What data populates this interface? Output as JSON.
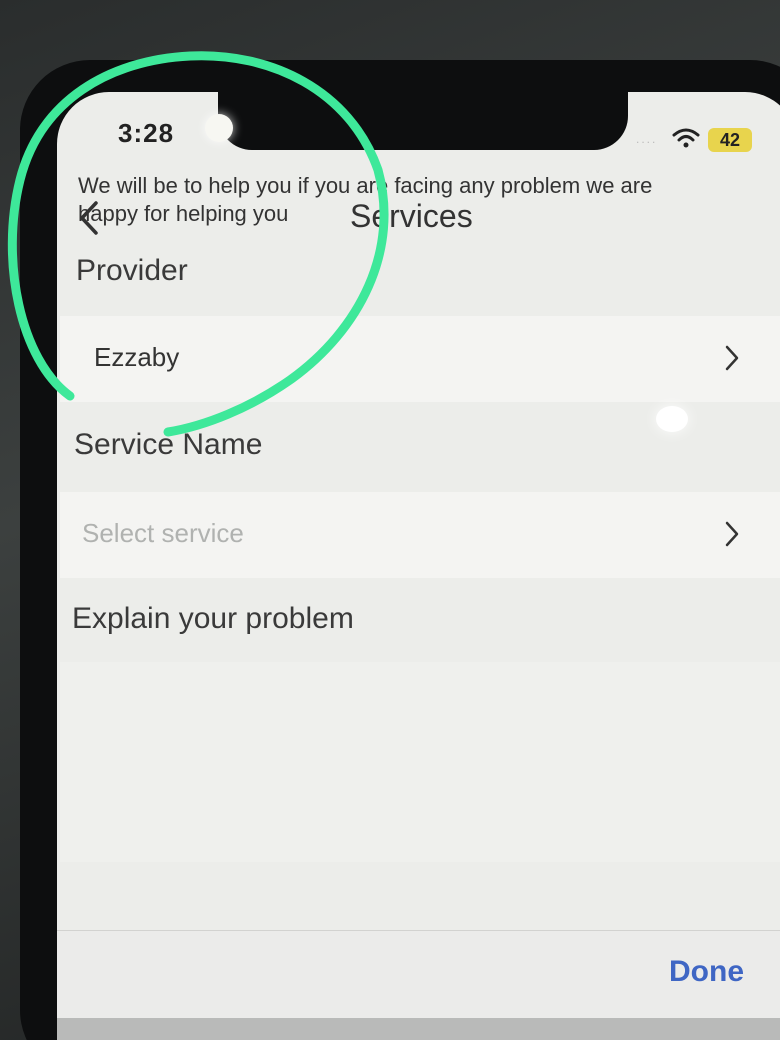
{
  "status_bar": {
    "time": "3:28",
    "battery": "42",
    "dots": "....",
    "wifi_icon": "wifi-icon"
  },
  "header": {
    "help_line1": "We will be to help you if you are facing any problem we are",
    "help_line2": "happy for helping you",
    "title": "Services",
    "back_icon": "chevron-left-icon"
  },
  "form": {
    "provider_label": "Provider",
    "provider_value": "Ezzaby",
    "service_label": "Service Name",
    "service_placeholder": "Select service",
    "problem_label": "Explain your problem",
    "problem_value": ""
  },
  "toolbar": {
    "done_label": "Done"
  },
  "colors": {
    "accent": "#3f66c4",
    "annotation": "#3ee89a",
    "battery": "#e8d44d"
  }
}
